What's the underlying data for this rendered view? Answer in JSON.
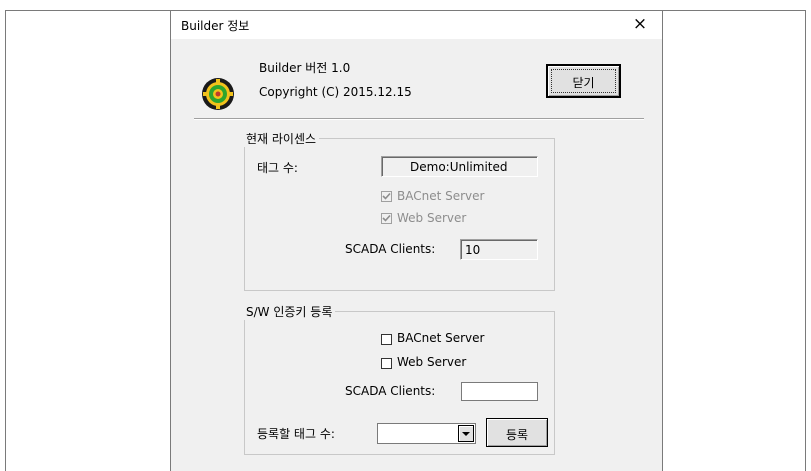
{
  "window": {
    "title": "Builder 정보",
    "close_glyph": "×"
  },
  "about": {
    "version": "Builder 버전 1.0",
    "copyright": "Copyright (C) 2015.12.15",
    "close_button": "닫기"
  },
  "current_license": {
    "group_label": "현재 라이센스",
    "tag_count_label": "태그 수:",
    "tag_count_value": "Demo:Unlimited",
    "bacnet_label": "BACnet Server",
    "bacnet_checked": true,
    "web_label": "Web Server",
    "web_checked": true,
    "scada_label": "SCADA Clients:",
    "scada_value": "10"
  },
  "sw_register": {
    "group_label": "S/W 인증키 등록",
    "bacnet_label": "BACnet Server",
    "web_label": "Web Server",
    "scada_label": "SCADA Clients:",
    "scada_value": "",
    "tag_count_label": "등록할 태그 수:",
    "tag_count_selected": "",
    "register_button": "등록"
  },
  "colors": {
    "dialog_bg": "#f0f0f0",
    "disabled_text": "#8d8d8d",
    "button_face": "#e1e1e1"
  },
  "icons": [
    "close-icon",
    "app-gear-icon",
    "checkmark-icon",
    "dropdown-arrow-icon"
  ]
}
